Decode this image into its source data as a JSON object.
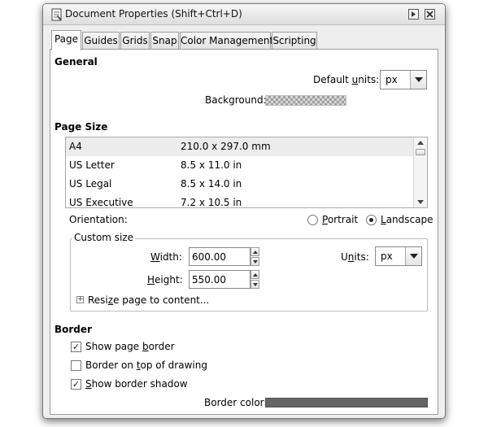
{
  "window": {
    "title": "Document Properties (Shift+Ctrl+D)",
    "titlebar_buttons": [
      {
        "icon": "restore-icon"
      },
      {
        "icon": "close-icon"
      }
    ]
  },
  "tabs": [
    {
      "label": "Page",
      "active": true
    },
    {
      "label": "Guides",
      "active": false
    },
    {
      "label": "Grids",
      "active": false
    },
    {
      "label": "Snap",
      "active": false
    },
    {
      "label": "Color Management",
      "active": false
    },
    {
      "label": "Scripting",
      "active": false
    }
  ],
  "general": {
    "title": "General",
    "default_units_pre": "Default ",
    "default_units_mnemonic": "u",
    "default_units_post": "nits:",
    "default_units_value": "px",
    "background_label": "Background:"
  },
  "page_size": {
    "title": "Page Size",
    "rows": [
      {
        "name": "A4",
        "size": "210.0 x 297.0 mm"
      },
      {
        "name": "US Letter",
        "size": "8.5 x 11.0 in"
      },
      {
        "name": "US Legal",
        "size": "8.5 x 14.0 in"
      },
      {
        "name": "US Executive",
        "size": "7.2 x 10.5 in"
      }
    ],
    "selected_row": "A4",
    "orientation_label": "Orientation:",
    "portrait_mnemonic": "P",
    "portrait_rest": "ortrait",
    "landscape_mnemonic": "L",
    "landscape_rest": "andscape",
    "orientation_selected": "Landscape"
  },
  "custom_size": {
    "legend": "Custom size",
    "width_mnemonic": "W",
    "width_rest": "idth:",
    "width_value": "600.00",
    "height_mnemonic": "H",
    "height_rest": "eight:",
    "height_value": "550.00",
    "units_pre": "U",
    "units_mnemonic": "n",
    "units_post": "its:",
    "units_value": "px",
    "resize_pre": "Resi",
    "resize_mnemonic": "z",
    "resize_post": "e page to content..."
  },
  "border": {
    "title": "Border",
    "show_page_border_pre": "Show page ",
    "show_page_border_mnemonic": "b",
    "show_page_border_post": "order",
    "show_page_border_checked": true,
    "border_on_top_pre": "Border on ",
    "border_on_top_mnemonic": "t",
    "border_on_top_post": "op of drawing",
    "border_on_top_checked": false,
    "show_shadow_pre": "",
    "show_shadow_mnemonic": "S",
    "show_shadow_post": "how border shadow",
    "show_shadow_checked": true,
    "border_color_label": "Border color:",
    "border_color_value": "#646464"
  }
}
